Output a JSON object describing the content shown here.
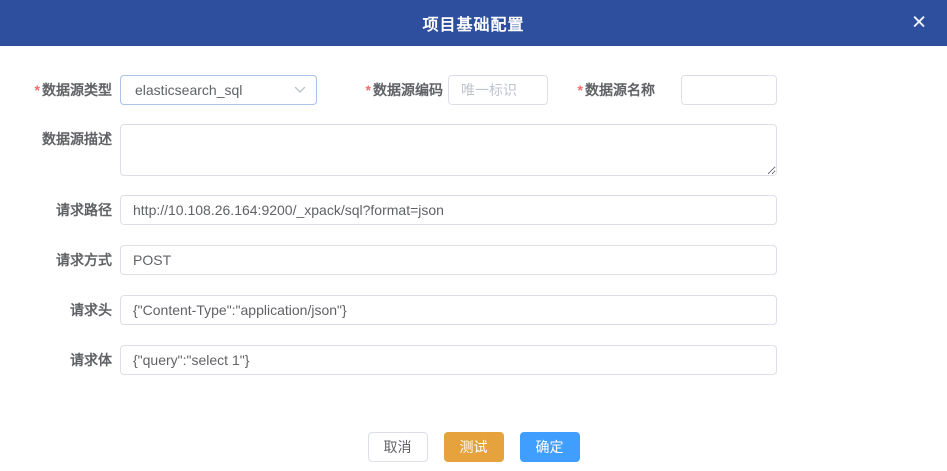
{
  "dialog": {
    "title": "项目基础配置",
    "close_glyph": "✕"
  },
  "required_mark": "*",
  "form": {
    "type": {
      "label": "数据源类型",
      "value": "elasticsearch_sql"
    },
    "code": {
      "label": "数据源编码",
      "placeholder": "唯一标识",
      "value": ""
    },
    "name": {
      "label": "数据源名称",
      "value": ""
    },
    "desc": {
      "label": "数据源描述",
      "value": ""
    },
    "path": {
      "label": "请求路径",
      "value": "http://10.108.26.164:9200/_xpack/sql?format=json"
    },
    "method": {
      "label": "请求方式",
      "value": "POST"
    },
    "headers": {
      "label": "请求头",
      "value": "{\"Content-Type\":\"application/json\"}"
    },
    "body": {
      "label": "请求体",
      "value": "{\"query\":\"select 1\"}"
    }
  },
  "footer": {
    "cancel_label": "取消",
    "test_label": "测试",
    "confirm_label": "确定"
  },
  "colors": {
    "header_bg": "#2e4f9e",
    "primary": "#409eff",
    "warning": "#e6a23c",
    "required": "#f56c6c"
  }
}
